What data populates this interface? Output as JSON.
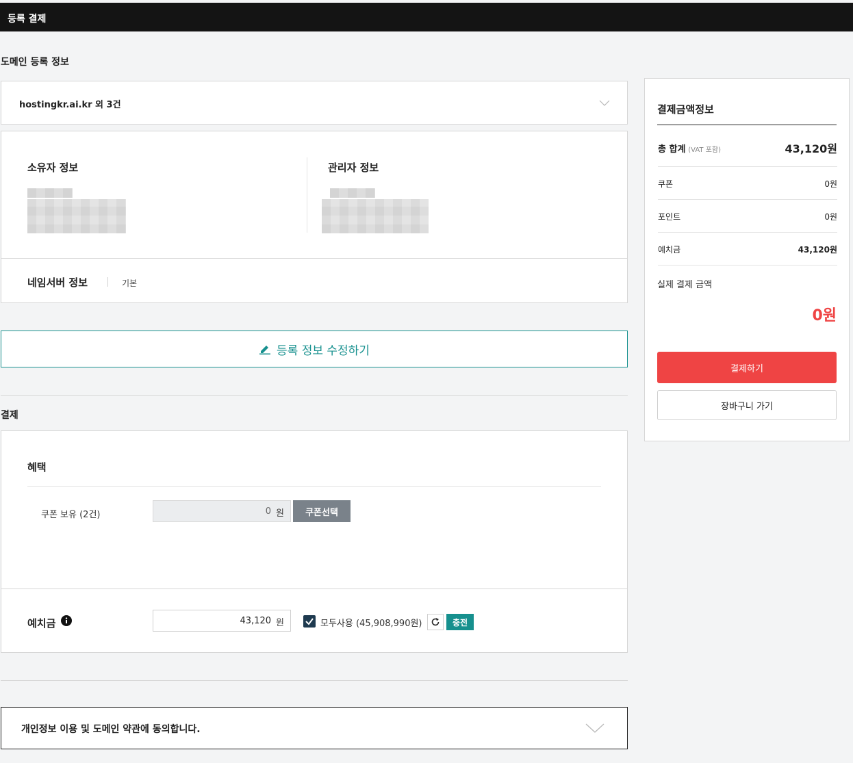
{
  "header": {
    "title": "등록 결제"
  },
  "domain_section": {
    "title": "도메인 등록 정보",
    "domain_summary": "hostingkr.ai.kr 외 3건",
    "owner_title": "소유자 정보",
    "admin_title": "관리자 정보",
    "nameserver_title": "네임서버 정보",
    "nameserver_value": "기본",
    "edit_button": "등록 정보 수정하기"
  },
  "payment_section": {
    "title": "결제",
    "benefit_title": "혜택",
    "coupon_label": "쿠폰 보유 (2건)",
    "coupon_value": "0",
    "coupon_unit": "원",
    "coupon_button": "쿠폰선택",
    "deposit_label": "예치금",
    "deposit_value": "43,120",
    "deposit_unit": "원",
    "use_all_label": "모두사용 (45,908,990원)",
    "use_all_checked": true,
    "charge_button": "충전"
  },
  "agreement": {
    "label": "개인정보 이용 및 도메인 약관에 동의합니다."
  },
  "summary": {
    "title": "결제금액정보",
    "total_label": "총 합계",
    "total_note": "(VAT 포함)",
    "total_value": "43,120원",
    "coupon_label": "쿠폰",
    "coupon_value": "0원",
    "point_label": "포인트",
    "point_value": "0원",
    "deposit_label": "예치금",
    "deposit_value": "43,120원",
    "actual_label": "실제 결제 금액",
    "actual_value": "0원",
    "pay_button": "결제하기",
    "cart_button": "장바구니 가기"
  },
  "colors": {
    "accent_teal": "#16908e",
    "pay_red": "#ef4444",
    "dark": "#141414"
  },
  "icons": [
    "chevron-down-icon",
    "pencil-icon",
    "info-icon",
    "check-icon",
    "refresh-icon"
  ]
}
